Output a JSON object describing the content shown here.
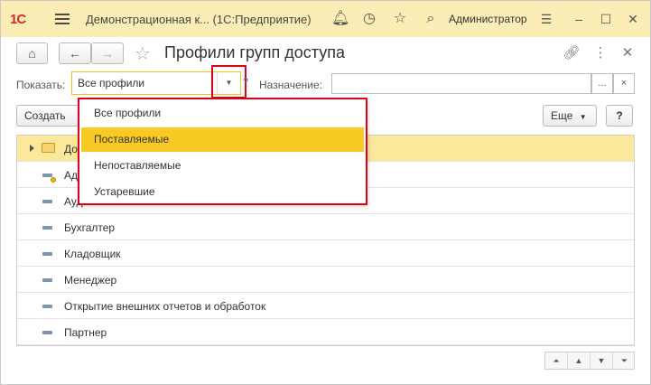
{
  "titlebar": {
    "logo": "1С",
    "app_title": "Демонстрационная к... (1С:Предприятие)",
    "user": "Администратор"
  },
  "form": {
    "title": "Профили групп доступа"
  },
  "filter": {
    "show_label": "Показать:",
    "show_value": "Все профили",
    "purpose_label": "Назначение:",
    "purpose_value": "",
    "select_button": "...",
    "clear_button": "×",
    "help_mark": "?"
  },
  "commands": {
    "create": "Создать",
    "more": "Еще",
    "help": "?"
  },
  "dropdown": {
    "options": [
      "Все профили",
      "Поставляемые",
      "Непоставляемые",
      "Устаревшие"
    ],
    "selected_index": 1
  },
  "list": {
    "rows": [
      {
        "text": "До",
        "kind": "folder"
      },
      {
        "text": "Ад",
        "kind": "item-marked"
      },
      {
        "text": "Ауд",
        "kind": "item"
      },
      {
        "text": "Бухгалтер",
        "kind": "item"
      },
      {
        "text": "Кладовщик",
        "kind": "item"
      },
      {
        "text": "Менеджер",
        "kind": "item"
      },
      {
        "text": "Открытие внешних отчетов и обработок",
        "kind": "item"
      },
      {
        "text": "Партнер",
        "kind": "item"
      }
    ]
  },
  "colors": {
    "titlebar_bg": "#fbedb5",
    "selected_row": "#fbe89a",
    "dropdown_selected": "#f9ca24",
    "highlight_frame": "#e0001b"
  }
}
